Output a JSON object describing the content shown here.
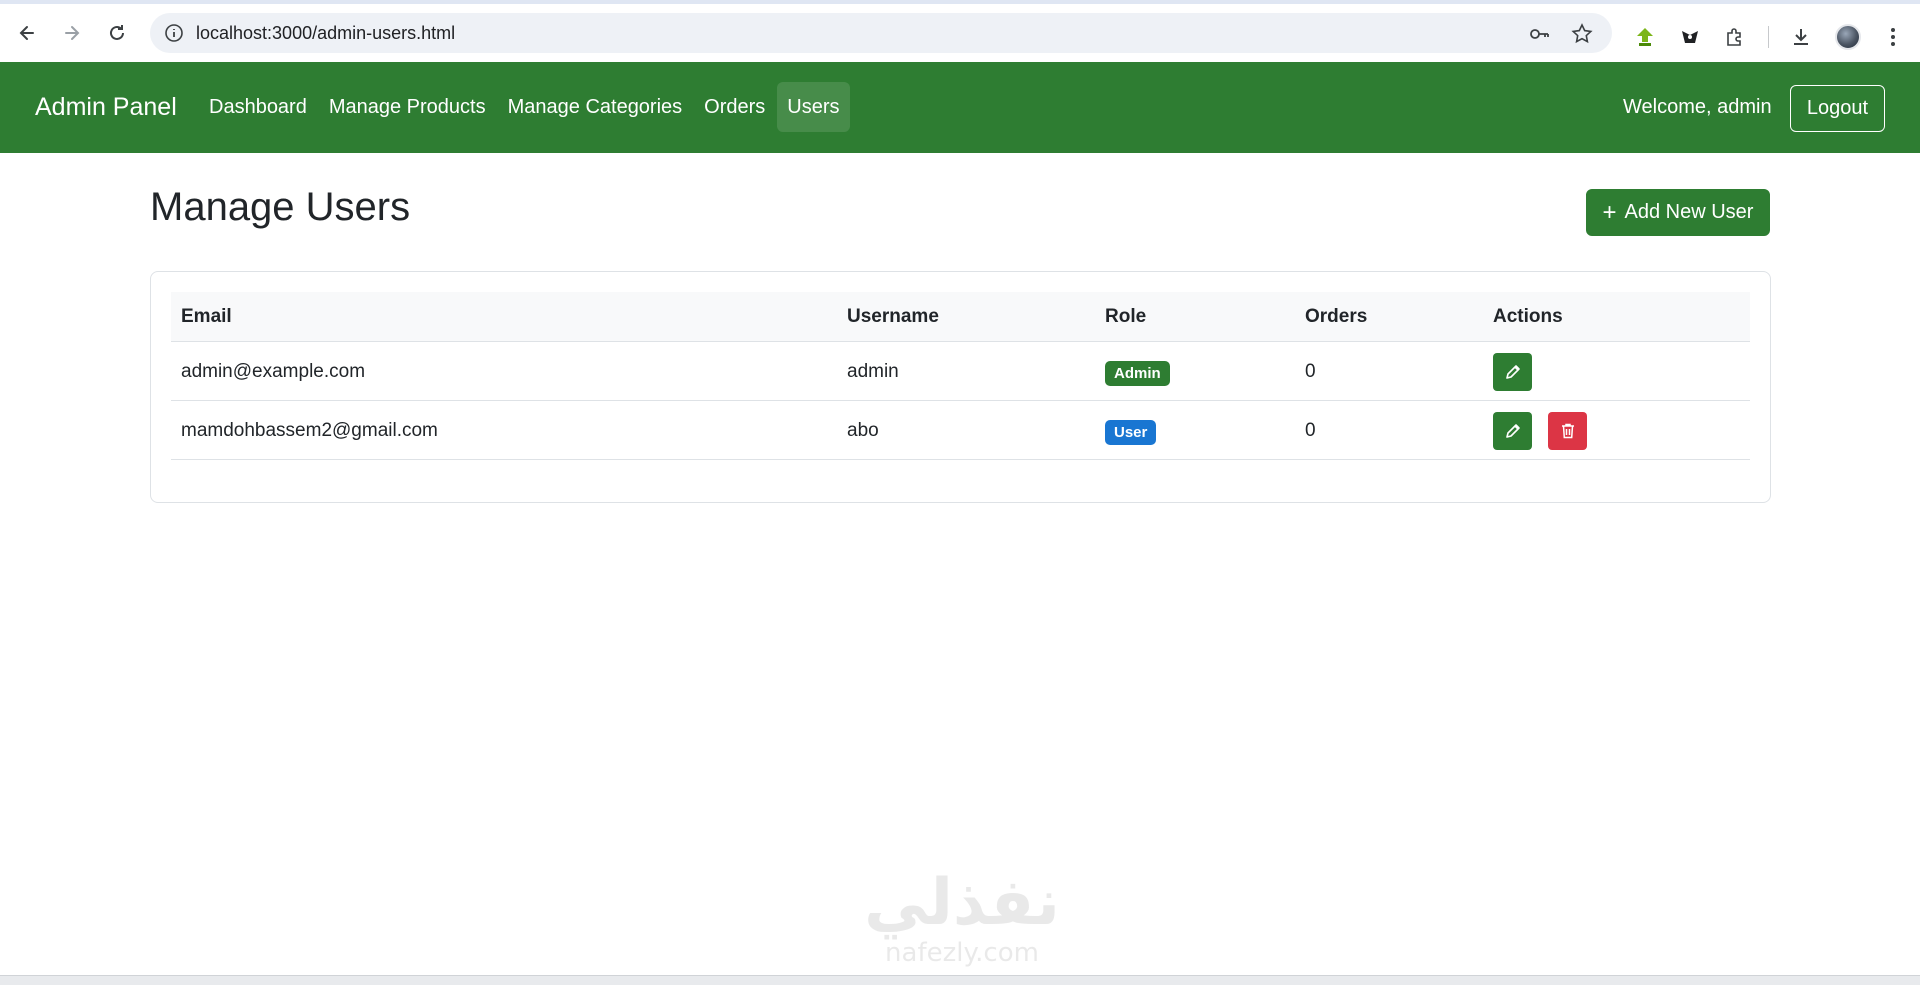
{
  "browser": {
    "url": "localhost:3000/admin-users.html"
  },
  "navbar": {
    "brand": "Admin Panel",
    "links": [
      {
        "label": "Dashboard"
      },
      {
        "label": "Manage Products"
      },
      {
        "label": "Manage Categories"
      },
      {
        "label": "Orders"
      },
      {
        "label": "Users"
      }
    ],
    "active_link": "Users",
    "welcome": "Welcome, admin",
    "logout_label": "Logout"
  },
  "page": {
    "title": "Manage Users",
    "add_button_icon": "+",
    "add_button_label": "Add New User"
  },
  "table": {
    "headers": {
      "email": "Email",
      "username": "Username",
      "role": "Role",
      "orders": "Orders",
      "actions": "Actions"
    },
    "rows": [
      {
        "email": "admin@example.com",
        "username": "admin",
        "role": "Admin",
        "orders": "0",
        "can_delete": false
      },
      {
        "email": "mamdohbassem2@gmail.com",
        "username": "abo",
        "role": "User",
        "orders": "0",
        "can_delete": true
      }
    ]
  },
  "watermark": {
    "main": "نفذلي",
    "sub": "nafezly.com"
  },
  "colors": {
    "primary": "#2e7d32",
    "admin_badge": "#2e7d32",
    "user_badge": "#1976d2",
    "danger": "#dc3545"
  }
}
